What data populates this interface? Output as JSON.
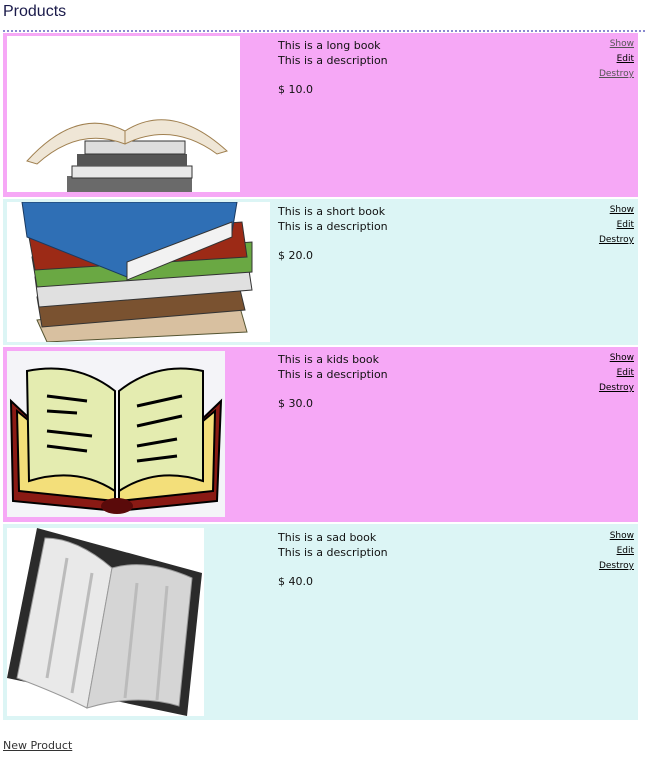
{
  "page": {
    "title": "Products",
    "new_product_label": "New Product"
  },
  "products": [
    {
      "title": "This is a long book",
      "description": "This is a description",
      "price": "$ 10.0",
      "actions": {
        "show": "Show",
        "edit": "Edit",
        "destroy": "Destroy"
      }
    },
    {
      "title": "This is a short book",
      "description": "This is a description",
      "price": "$ 20.0",
      "actions": {
        "show": "Show",
        "edit": "Edit",
        "destroy": "Destroy"
      }
    },
    {
      "title": "This is a kids book",
      "description": "This is a description",
      "price": "$ 30.0",
      "actions": {
        "show": "Show",
        "edit": "Edit",
        "destroy": "Destroy"
      }
    },
    {
      "title": "This is a sad book",
      "description": "This is a description",
      "price": "$ 40.0",
      "actions": {
        "show": "Show",
        "edit": "Edit",
        "destroy": "Destroy"
      }
    }
  ],
  "colors": {
    "row_odd": "#f6a8f6",
    "row_even": "#dcf5f5"
  }
}
